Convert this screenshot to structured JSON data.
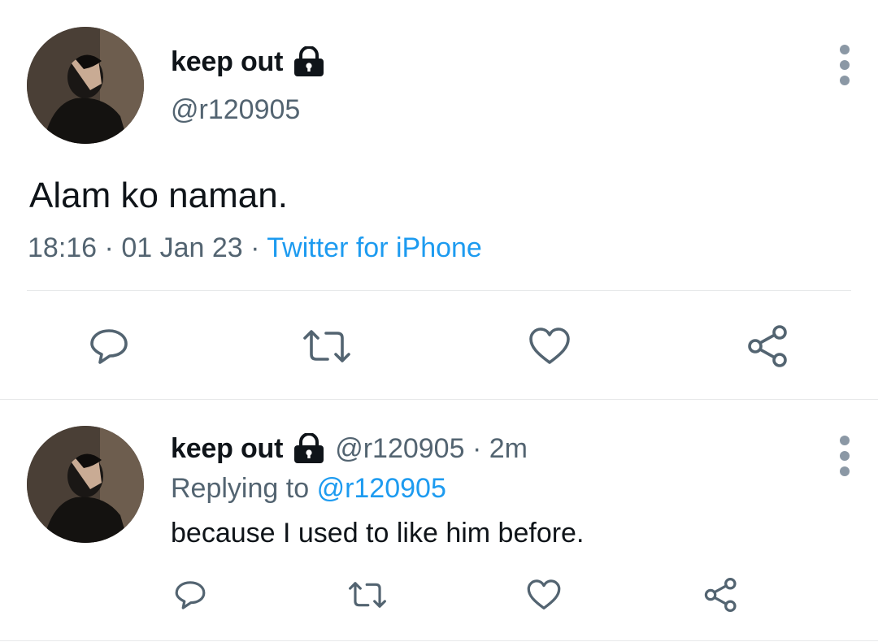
{
  "main_tweet": {
    "author_name": "keep out",
    "author_handle": "@r120905",
    "text": "Alam ko naman.",
    "time": "18:16",
    "date": "01 Jan 23",
    "source": "Twitter for iPhone"
  },
  "reply": {
    "author_name": "keep out",
    "author_handle": "@r120905",
    "age": "2m",
    "replying_prefix": "Replying to",
    "replying_handle": "@r120905",
    "text": "because I used to like him before."
  },
  "icons": {
    "lock": "lock-icon",
    "more": "more-icon",
    "reply": "reply-icon",
    "retweet": "retweet-icon",
    "like": "heart-icon",
    "share": "share-icon"
  },
  "colors": {
    "link_blue": "#1d9bf0",
    "secondary_text": "#536471",
    "primary_text": "#0f1419",
    "divider": "#e7e9ea"
  }
}
